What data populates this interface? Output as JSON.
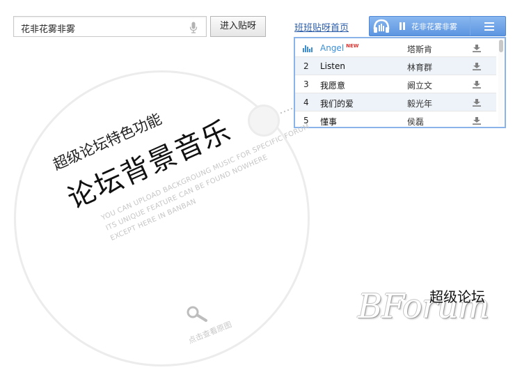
{
  "search": {
    "value": "花非花雾非雾",
    "button_label": "进入贴呀"
  },
  "header": {
    "home_link": "班班贴呀首页"
  },
  "player": {
    "now_playing": "花非花雾非雾",
    "icons": {
      "logo": "headphone-icon",
      "pause": "pause-icon",
      "menu": "menu-icon"
    },
    "accent_color": "#5c95e0",
    "tracks": [
      {
        "num": "",
        "title": "Angel",
        "tag": "NEW",
        "artist": "塔斯肯",
        "playing": true
      },
      {
        "num": "2",
        "title": "Listen",
        "artist": "林育群"
      },
      {
        "num": "3",
        "title": "我愿意",
        "artist": "阚立文"
      },
      {
        "num": "4",
        "title": "我们的爱",
        "artist": "毅光年"
      },
      {
        "num": "5",
        "title": "懂事",
        "artist": "侯磊"
      }
    ]
  },
  "feature": {
    "subtitle": "超级论坛特色功能",
    "title": "论坛背景音乐",
    "english": [
      "YOU CAN UPLOAD BACKGROUNG MUSIC FOR SPECIFIC FORUM",
      "ITS UNIQUE FEATURE CAN BE FOUND NOWHERE",
      "EXCEPT HERE IN BANBAN"
    ],
    "zoom_label": "点击查看原图"
  },
  "logo": {
    "cn": "超级论坛",
    "en": "BForum"
  }
}
